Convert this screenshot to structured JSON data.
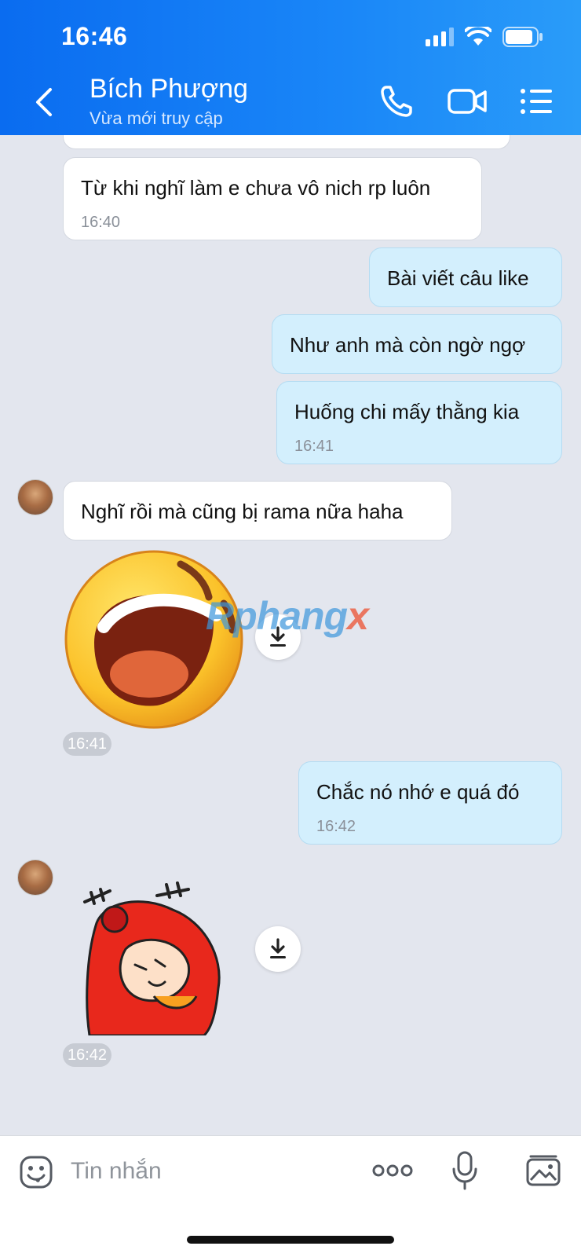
{
  "status_bar": {
    "time": "16:46"
  },
  "header": {
    "contact_name": "Bích Phượng",
    "contact_status": "Vừa mới truy cập"
  },
  "messages": [
    {
      "direction": "in",
      "text": "Từ khi nghĩ làm e chưa vô nich rp luôn",
      "time": "16:40"
    },
    {
      "direction": "out",
      "text": "Bài viết câu like"
    },
    {
      "direction": "out",
      "text": "Như anh mà còn ngờ ngợ"
    },
    {
      "direction": "out",
      "text": "Huống chi mấy thằng kia",
      "time": "16:41"
    },
    {
      "direction": "in",
      "text": "Nghĩ rồi mà cũng bị rama nữa haha"
    },
    {
      "direction": "in",
      "sticker": "laughing-face",
      "time": "16:41"
    },
    {
      "direction": "out",
      "text": "Chắc nó nhớ e quá đó",
      "time": "16:42"
    },
    {
      "direction": "in",
      "sticker": "red-monkey",
      "time": "16:42"
    }
  ],
  "watermark": {
    "main": "Rphang",
    "suffix": "x"
  },
  "composer": {
    "placeholder": "Tin nhắn"
  },
  "colors": {
    "header": "#1a87f8",
    "outgoing": "#d3effd",
    "incoming": "#ffffff",
    "background": "#e3e6ee"
  }
}
